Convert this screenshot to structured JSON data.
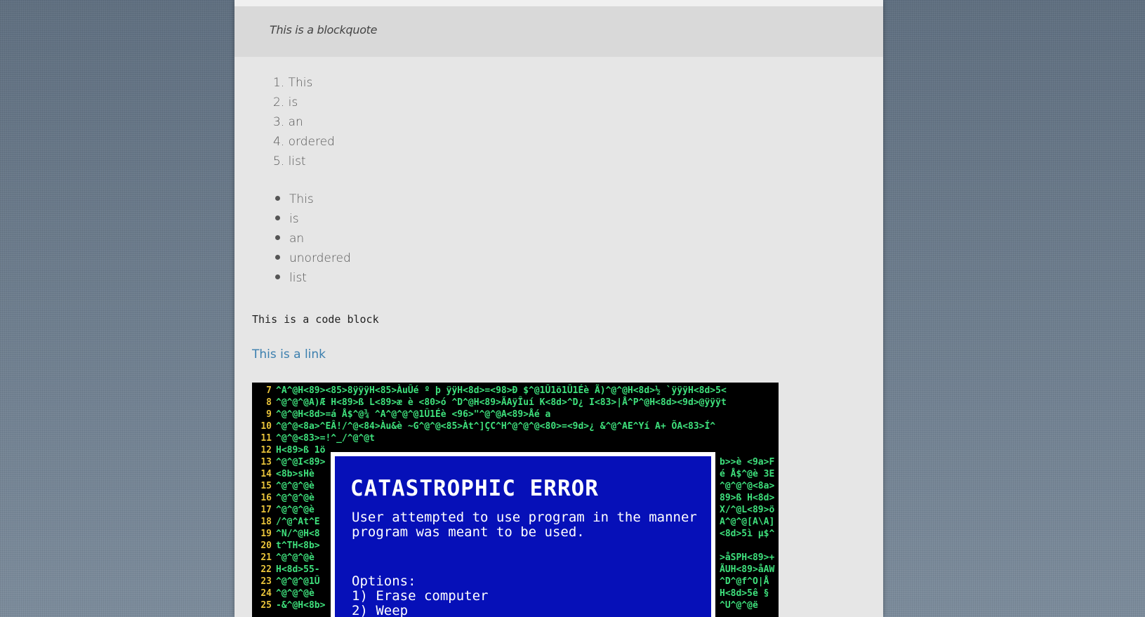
{
  "blockquote": "This is a blockquote",
  "ordered_list": [
    "1. This",
    "2. is",
    "3. an",
    "4. ordered",
    "5. list"
  ],
  "unordered_list": [
    "This",
    "is",
    "an",
    "unordered",
    "list"
  ],
  "code_block": "This is a code block",
  "link": "This is a link",
  "image": {
    "terminal_lines": [
      {
        "n": "7",
        "t": "^A^@H<89><85>8ÿÿÿH<85>ÀuÛé º þ ÿÿH<8d>=<98>Ð $^@1Û1ö1Û1Éè Ã)^@^@H<8d>½ `ÿÿÿH<8d>5<"
      },
      {
        "n": "8",
        "t": "^@^@^@A)Æ H<89>ß L<89>æ è <80>ó ^D^@H<89>ÃAÿÎuí K<8d>^D¿ I<83>|Å^P^@H<8d><9d>@ÿÿÿt"
      },
      {
        "n": "9",
        "t": "^@^@H<8d>=á Å$^@¾ ^A^@^@^@1Û1Éè <96>\"^@^@A<89>Åé a"
      },
      {
        "n": "10",
        "t": "^@^@<8a>^EÂ!/^@<84>Àu&è ~G^@^@<85>Àt^]ÇC^H^@^@^@<80>=<9d>¿ &^@^AE^Yí A+ ÕA<83>Í^"
      },
      {
        "n": "11",
        "t": "^@^@<83>=!^_/^@^@t"
      },
      {
        "n": "12",
        "t": "H<89>ß 1ö"
      },
      {
        "n": "13",
        "t": "^@^@I<89>"
      },
      {
        "n": "14",
        "t": "<8b>sHè"
      },
      {
        "n": "15",
        "t": "^@^@^@è"
      },
      {
        "n": "16",
        "t": "^@^@^@è"
      },
      {
        "n": "17",
        "t": "^@^@^@è"
      },
      {
        "n": "18",
        "t": "/^@^At^E"
      },
      {
        "n": "19",
        "t": "^N/^@H<8"
      },
      {
        "n": "20",
        "t": "t^TH<8b>"
      },
      {
        "n": "21",
        "t": "^@^@^@è"
      },
      {
        "n": "22",
        "t": "H<8d>55-"
      },
      {
        "n": "23",
        "t": "^@^@^@1Û"
      },
      {
        "n": "24",
        "t": "^@^@^@è"
      },
      {
        "n": "25",
        "t": "-&^@H<8b>"
      }
    ],
    "right_fragments": [
      "b>>è <9a>F",
      "é Å$^@è 3E",
      "^@^@^@<8a>",
      "89>ß H<8d>",
      "X/^@L<89>ö",
      "A^@^@[A\\A]",
      "<8d>5ì µ$^",
      "",
      ">åSPH<89>+",
      "ÃUH<89>åAW",
      " ^D^@f^O|Å",
      "H<8d>5ê §",
      " ^U^@^@ë"
    ],
    "dialog": {
      "title": "CATASTROPHIC ERROR",
      "message_line1": "User attempted to use program in the manner",
      "message_line2": "program was meant to be used.",
      "options_label": "Options:",
      "option1": "1) Erase computer",
      "option2": "2) Weep"
    }
  }
}
